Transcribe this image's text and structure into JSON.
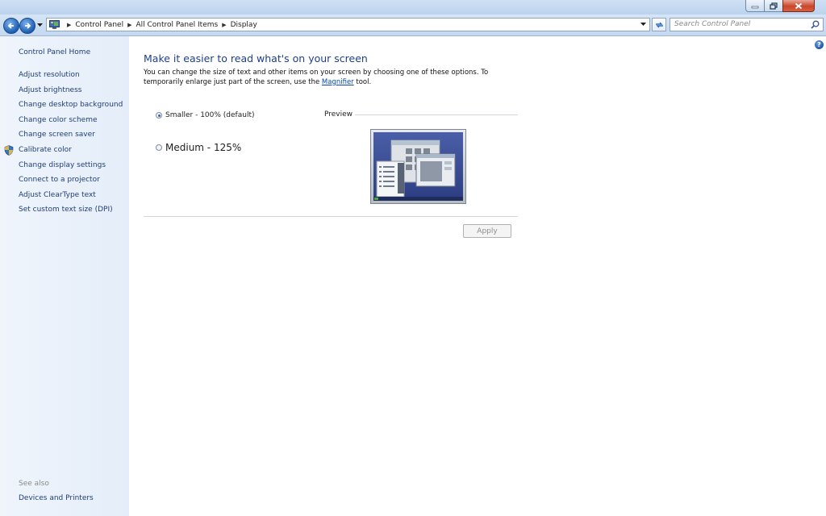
{
  "window": {
    "controls": [
      "minimize-icon",
      "restore-icon",
      "close-icon"
    ]
  },
  "address_bar": {
    "breadcrumbs": [
      "Control Panel",
      "All Control Panel Items",
      "Display"
    ],
    "search_placeholder": "Search Control Panel"
  },
  "sidebar": {
    "home": "Control Panel Home",
    "items": [
      {
        "label": "Adjust resolution"
      },
      {
        "label": "Adjust brightness"
      },
      {
        "label": "Change desktop background"
      },
      {
        "label": "Change color scheme"
      },
      {
        "label": "Change screen saver"
      },
      {
        "label": "Calibrate color",
        "icon": "shield-icon"
      },
      {
        "label": "Change display settings"
      },
      {
        "label": "Connect to a projector"
      },
      {
        "label": "Adjust ClearType text"
      },
      {
        "label": "Set custom text size (DPI)"
      }
    ],
    "see_also": "See also",
    "see_also_items": [
      "Devices and Printers"
    ]
  },
  "main": {
    "title": "Make it easier to read what's on your screen",
    "description_before": "You can change the size of text and other items on your screen by choosing one of these options. To temporarily enlarge just part of the screen, use the ",
    "description_link": "Magnifier",
    "description_after": " tool.",
    "options": [
      {
        "label": "Smaller - 100% (default)",
        "selected": true
      },
      {
        "label": "Medium - 125%",
        "selected": false
      }
    ],
    "preview_label": "Preview",
    "apply_label": "Apply",
    "help_icon": "help-icon"
  },
  "colors": {
    "link": "#1e3e7a",
    "title": "#1e3f8a",
    "preview_desktop": "#3b4f9a"
  }
}
